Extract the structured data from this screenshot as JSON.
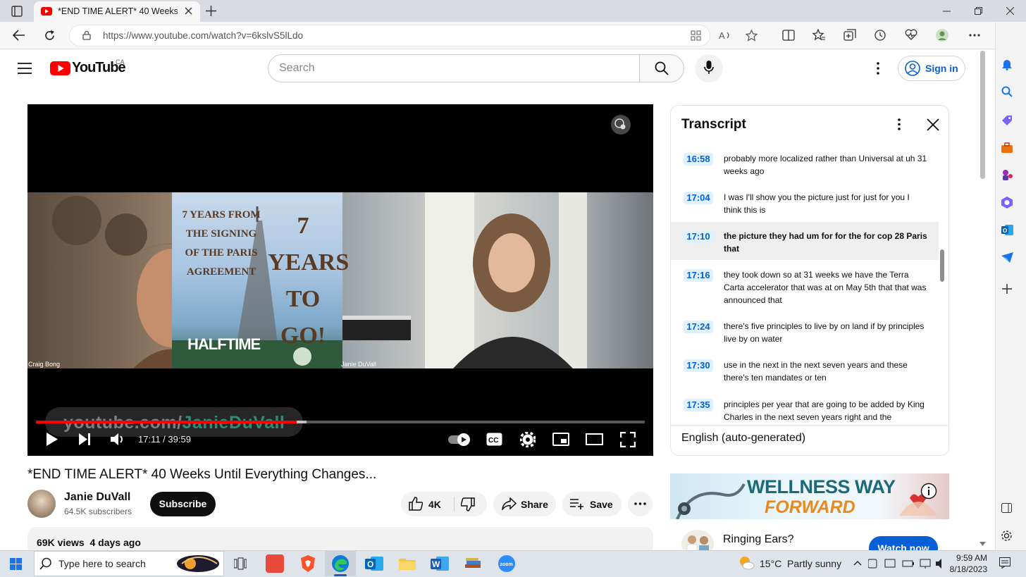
{
  "browser": {
    "tab_title": "*END TIME ALERT* 40 Weeks Until Everything Changes...",
    "url": "https://www.youtube.com/watch?v=6kslvS5lLdo"
  },
  "youtube": {
    "logo_text": "YouTube",
    "region": "CA",
    "search_placeholder": "Search",
    "signin_label": "Sign in"
  },
  "player": {
    "poster_line1": "7 YEARS FROM THE SIGNING OF THE PARIS AGREEMENT",
    "poster_line2": "7 YEARS TO GO!",
    "poster_banner": "HALFTIME",
    "participant_left": "Craig Bong",
    "participant_right": "Janie DuVall",
    "watermark_prefix": "youtube.com/",
    "watermark_channel": "JanieDuVall",
    "current_time": "17:11",
    "duration": "39:59",
    "time_display": "17:11 / 39:59",
    "progress_fraction": 0.428,
    "buffered_fraction": 0.445
  },
  "transcript": {
    "title": "Transcript",
    "language": "English (auto-generated)",
    "segments": [
      {
        "time": "16:58",
        "text": "probably more localized rather than Universal at uh 31 weeks ago"
      },
      {
        "time": "17:04",
        "text": "I was I'll show you the picture just for just for you I think this is"
      },
      {
        "time": "17:10",
        "text": "the picture they had um for for the for cop 28 Paris that",
        "active": true
      },
      {
        "time": "17:16",
        "text": "they took down so at 31 weeks we have the Terra Carta accelerator that was at on May 5th that that was announced that"
      },
      {
        "time": "17:24",
        "text": "there's five principles to live by on land if by principles live by on water"
      },
      {
        "time": "17:30",
        "text": "use in the next in the next seven years and these there's ten mandates or ten"
      },
      {
        "time": "17:35",
        "text": "principles per year that are going to be added by King Charles in the next seven years right and the mandates"
      }
    ]
  },
  "video": {
    "title": "*END TIME ALERT* 40 Weeks Until Everything Changes...",
    "channel": "Janie DuVall",
    "subscribers": "64.5K subscribers",
    "subscribe_label": "Subscribe",
    "likes": "4K",
    "share_label": "Share",
    "save_label": "Save",
    "views": "69K views",
    "age": "4 days ago"
  },
  "ad": {
    "banner_line1": "WELLNESS WAY",
    "banner_line2": "FORWARD",
    "headline": "Ringing Ears?",
    "cta": "Watch now"
  },
  "taskbar": {
    "search_placeholder": "Type here to search",
    "weather": "15°C  Partly sunny",
    "time": "9:59 AM",
    "date": "8/18/2023"
  },
  "colors": {
    "youtube_red": "#ff0000",
    "link_blue": "#065fd4",
    "time_chip_bg": "#def1ff"
  }
}
